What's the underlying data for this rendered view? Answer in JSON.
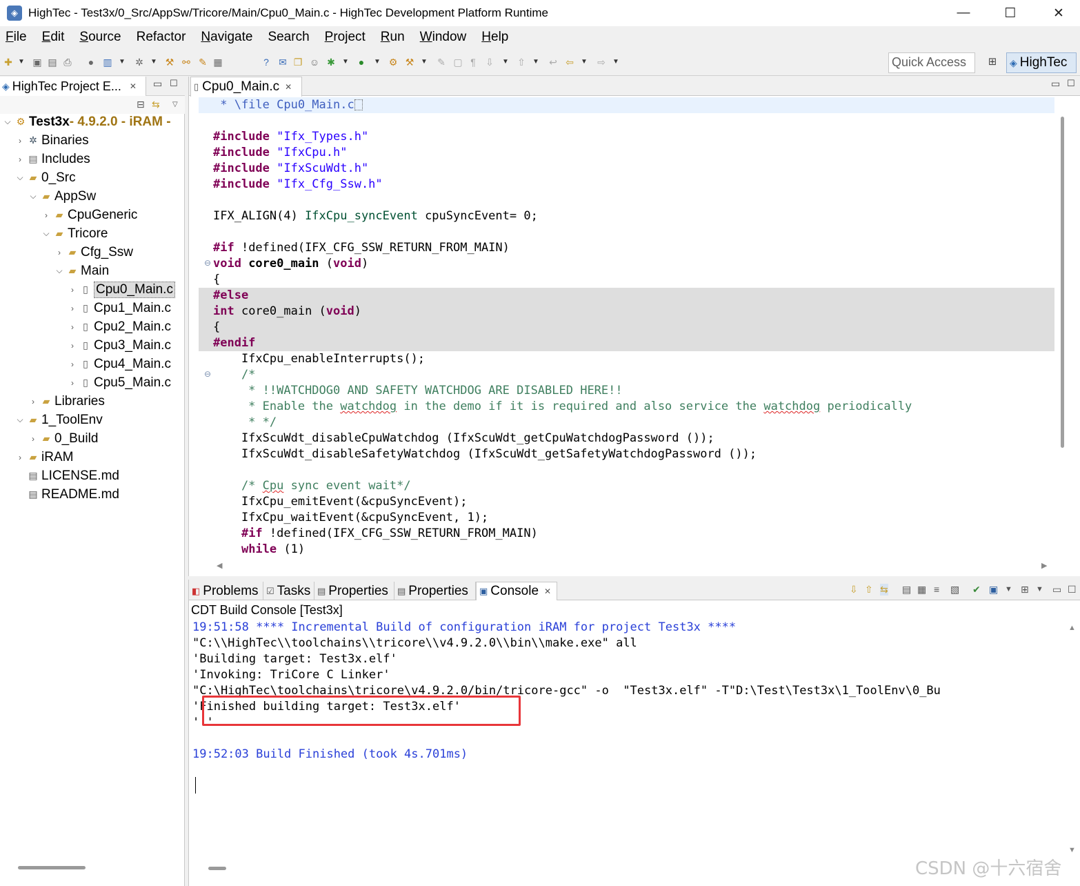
{
  "window": {
    "title": "HighTec - Test3x/0_Src/AppSw/Tricore/Main/Cpu0_Main.c - HighTec Development Platform Runtime",
    "icon": "hightec-app-icon",
    "minimize": "—",
    "maximize": "☐",
    "close": "✕"
  },
  "menu": [
    {
      "label": "File",
      "mnemonic": "F",
      "rest": "ile"
    },
    {
      "label": "Edit",
      "mnemonic": "E",
      "rest": "dit"
    },
    {
      "label": "Source",
      "mnemonic": "S",
      "rest": "ource"
    },
    {
      "label": "Refactor",
      "mnemonic": "",
      "rest": "Refactor"
    },
    {
      "label": "Navigate",
      "mnemonic": "N",
      "rest": "avigate"
    },
    {
      "label": "Search",
      "mnemonic": "",
      "rest": "Search"
    },
    {
      "label": "Project",
      "mnemonic": "P",
      "rest": "roject"
    },
    {
      "label": "Run",
      "mnemonic": "R",
      "rest": "un"
    },
    {
      "label": "Window",
      "mnemonic": "W",
      "rest": "indow"
    },
    {
      "label": "Help",
      "mnemonic": "H",
      "rest": "elp"
    }
  ],
  "toolbar": {
    "quick_access_placeholder": "Quick Access",
    "perspective": "HighTec"
  },
  "project_explorer": {
    "tab_title": "HighTec Project E...",
    "project": {
      "name": "Test3x",
      "decoration": " - 4.9.2.0 -  iRAM -"
    },
    "items": [
      {
        "label": "Binaries",
        "icon": "binaries-icon"
      },
      {
        "label": "Includes",
        "icon": "includes-icon"
      },
      {
        "label": "0_Src",
        "icon": "folder-icon"
      },
      {
        "label": "AppSw",
        "icon": "folder-icon"
      },
      {
        "label": "CpuGeneric",
        "icon": "folder-icon"
      },
      {
        "label": "Tricore",
        "icon": "folder-icon"
      },
      {
        "label": "Cfg_Ssw",
        "icon": "folder-icon"
      },
      {
        "label": "Main",
        "icon": "folder-icon"
      },
      {
        "label": "Cpu0_Main.c",
        "icon": "c-file-icon"
      },
      {
        "label": "Cpu1_Main.c",
        "icon": "c-file-icon"
      },
      {
        "label": "Cpu2_Main.c",
        "icon": "c-file-icon"
      },
      {
        "label": "Cpu3_Main.c",
        "icon": "c-file-icon"
      },
      {
        "label": "Cpu4_Main.c",
        "icon": "c-file-icon"
      },
      {
        "label": "Cpu5_Main.c",
        "icon": "c-file-icon"
      },
      {
        "label": "Libraries",
        "icon": "folder-icon"
      },
      {
        "label": "1_ToolEnv",
        "icon": "folder-icon"
      },
      {
        "label": "0_Build",
        "icon": "folder-icon"
      },
      {
        "label": "iRAM",
        "icon": "folder-icon"
      },
      {
        "label": "LICENSE.md",
        "icon": "text-file-icon"
      },
      {
        "label": "README.md",
        "icon": "text-file-icon"
      }
    ]
  },
  "editor": {
    "tab_title": "Cpu0_Main.c",
    "code": {
      "l0": " * \\file Cpu0_Main.c",
      "l2a": "#include",
      "l2b": " \"Ifx_Types.h\"",
      "l3a": "#include",
      "l3b": " \"IfxCpu.h\"",
      "l4a": "#include",
      "l4b": " \"IfxScuWdt.h\"",
      "l5a": "#include",
      "l5b": " \"Ifx_Cfg_Ssw.h\"",
      "l7a": "IFX_ALIGN(4) ",
      "l7b": "IfxCpu_syncEvent",
      "l7c": " cpuSyncEvent= 0;",
      "l9a": "#if",
      "l9b": " !defined(IFX_CFG_SSW_RETURN_FROM_MAIN)",
      "l10a": "void",
      "l10b": " core0_main",
      "l10c": " (",
      "l10d": "void",
      "l10e": ")",
      "l11": "{",
      "l12": "#else",
      "l13a": "int",
      "l13b": " core0_main (",
      "l13c": "void",
      "l13d": ")",
      "l14": "{",
      "l15": "#endif",
      "l16": "    IfxCpu_enableInterrupts();",
      "l17": "    /*",
      "l18": "     * !!WATCHDOG0 AND SAFETY WATCHDOG ARE DISABLED HERE!!",
      "l19a": "     * Enable the ",
      "l19b": "watchdog",
      "l19c": " in the demo if it is required and also service the ",
      "l19d": "watchdog",
      "l19e": " periodically",
      "l20": "     * */",
      "l21": "    IfxScuWdt_disableCpuWatchdog (IfxScuWdt_getCpuWatchdogPassword ());",
      "l22": "    IfxScuWdt_disableSafetyWatchdog (IfxScuWdt_getSafetyWatchdogPassword ());",
      "l24a": "    /* ",
      "l24b": "Cpu",
      "l24c": " sync event wait*/",
      "l25a": "    IfxCpu",
      "l25b": "_emitEvent(&cpuSyncEvent);",
      "l26": "    IfxCpu_waitEvent(&cpuSyncEvent, 1);",
      "l27a": "    ",
      "l27b": "#if",
      "l27c": " !defined(IFX_CFG_SSW_RETURN_FROM_MAIN)",
      "l28a": "    ",
      "l28b": "while",
      "l28c": " (1)"
    }
  },
  "bottom": {
    "tabs": [
      {
        "label": "Problems",
        "icon": "problems-icon"
      },
      {
        "label": "Tasks",
        "icon": "tasks-icon"
      },
      {
        "label": "Properties",
        "icon": "properties-icon"
      },
      {
        "label": "Properties",
        "icon": "properties-icon"
      },
      {
        "label": "Console",
        "icon": "console-icon"
      }
    ],
    "console_title": "CDT Build Console [Test3x]",
    "console_lines": [
      "19:51:58 **** Incremental Build of configuration iRAM for project Test3x ****",
      "\"C:\\\\HighTec\\\\toolchains\\\\tricore\\\\v4.9.2.0\\\\bin\\\\make.exe\" all",
      "'Building target: Test3x.elf'",
      "'Invoking: TriCore C Linker'",
      "\"C:\\HighTec\\toolchains\\tricore\\v4.9.2.0/bin/tricore-gcc\" -o  \"Test3x.elf\" -T\"D:\\Test\\Test3x\\1_ToolEnv\\0_Bu",
      "'Finished building target: Test3x.elf'",
      "' '",
      "",
      "19:52:03 Build Finished (took 4s.701ms)"
    ]
  },
  "watermark": "CSDN @十六宿舍",
  "colors": {
    "keyword": "#7f0055",
    "string": "#2a00ff",
    "comment": "#3f7f5f",
    "console_info": "#2a40d8",
    "highlight_box": "#e8363a"
  }
}
